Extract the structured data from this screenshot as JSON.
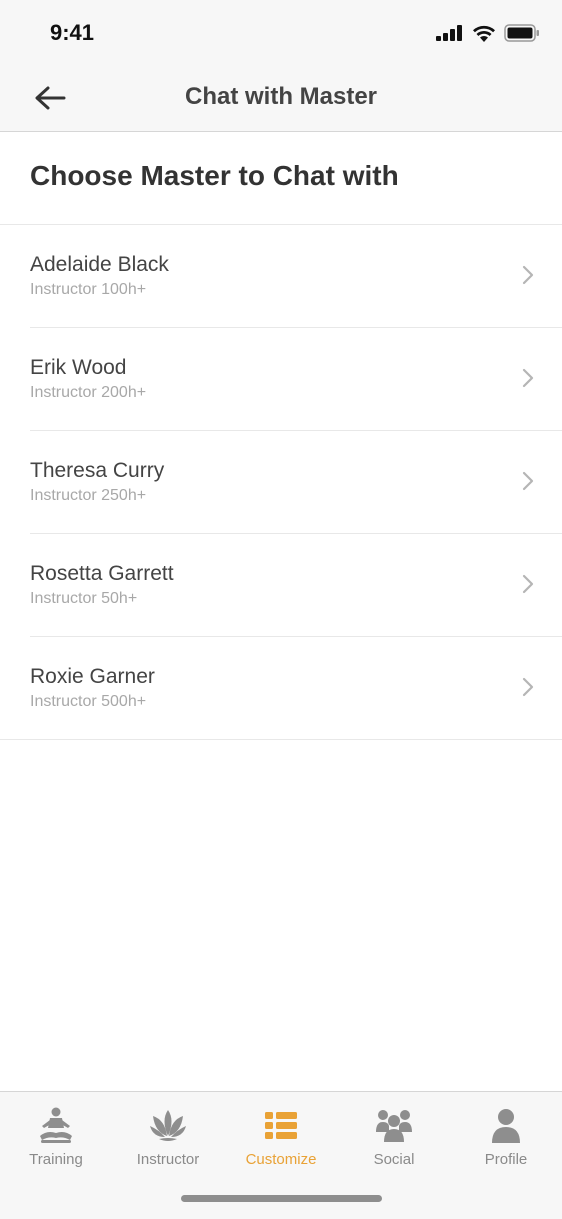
{
  "status_bar": {
    "time": "9:41"
  },
  "nav": {
    "title": "Chat with Master"
  },
  "section": {
    "title": "Choose Master to Chat with"
  },
  "masters": [
    {
      "name": "Adelaide Black",
      "subtitle": "Instructor 100h+"
    },
    {
      "name": "Erik Wood",
      "subtitle": "Instructor 200h+"
    },
    {
      "name": "Theresa Curry",
      "subtitle": "Instructor 250h+"
    },
    {
      "name": "Rosetta Garrett",
      "subtitle": "Instructor 50h+"
    },
    {
      "name": "Roxie Garner",
      "subtitle": "Instructor 500h+"
    }
  ],
  "tabs": [
    {
      "label": "Training",
      "icon": "meditation-icon"
    },
    {
      "label": "Instructor",
      "icon": "lotus-icon"
    },
    {
      "label": "Customize",
      "icon": "list-icon",
      "active": true
    },
    {
      "label": "Social",
      "icon": "group-icon"
    },
    {
      "label": "Profile",
      "icon": "person-icon"
    }
  ],
  "colors": {
    "accent": "#e9a236",
    "tab_inactive": "#8a8a8a",
    "icon_inactive": "#8e8e8e"
  }
}
